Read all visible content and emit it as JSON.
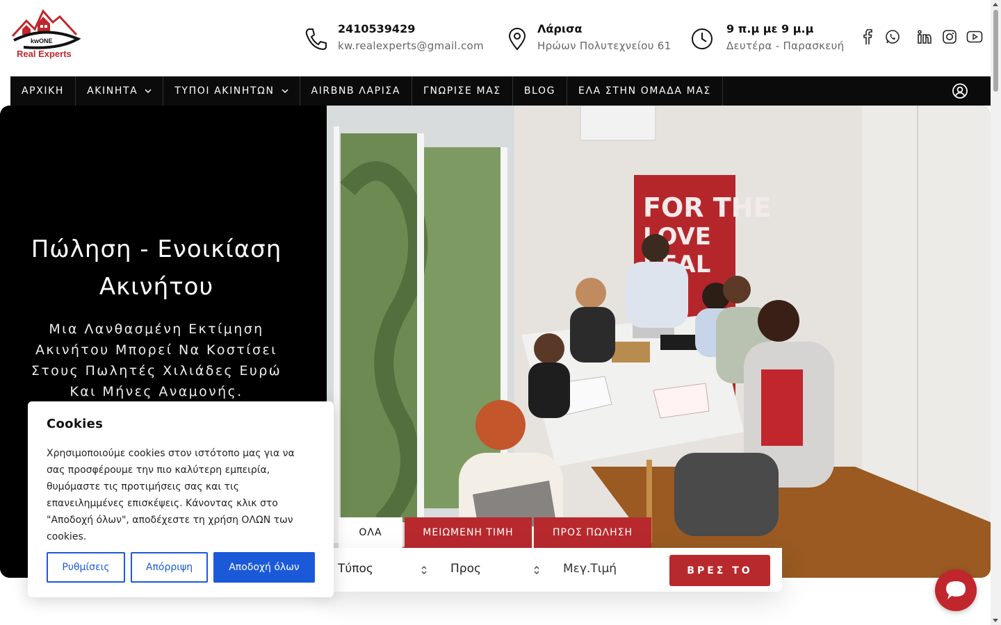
{
  "brand": {
    "name": "Real Experts",
    "sub_logo": "kwONE"
  },
  "header": {
    "phone": {
      "number": "2410539429",
      "email": "kw.realexperts@gmail.com",
      "icon": "phone-icon"
    },
    "location": {
      "city": "Λάρισα",
      "address": "Ηρώων Πολυτεχνείου 61",
      "icon": "map-pin-icon"
    },
    "hours": {
      "time": "9 π.μ με 9 μ.μ",
      "days": "Δευτέρα - Παρασκευή",
      "icon": "clock-icon"
    },
    "socials": [
      "facebook-icon",
      "whatsapp-icon",
      "linkedin-icon",
      "instagram-icon",
      "youtube-icon"
    ]
  },
  "nav": {
    "items": [
      {
        "label": "ΑΡΧΙΚΗ",
        "dropdown": false
      },
      {
        "label": "ΑΚΙΝΗΤΑ",
        "dropdown": true
      },
      {
        "label": "ΤΥΠΟΙ ΑΚΙΝΗΤΩΝ",
        "dropdown": true
      },
      {
        "label": "AIRBNB ΛΑΡΙΣΑ",
        "dropdown": false
      },
      {
        "label": "ΓΝΩΡΙΣΕ ΜΑΣ",
        "dropdown": false
      },
      {
        "label": "BLOG",
        "dropdown": false
      },
      {
        "label": "ΕΛΑ ΣΤΗΝ ΟΜΑΔΑ ΜΑΣ",
        "dropdown": false
      }
    ]
  },
  "hero": {
    "title": "Πώληση - Ενοικίαση Ακινήτου",
    "subtitle": "Μια Λανθασμένη Εκτίμηση Ακινήτου Μπορεί Να Κοστίσει Στους Πωλητές Χιλιάδες Ευρώ Και Μήνες Αναμονής."
  },
  "search": {
    "tabs": [
      "ΟΛΑ",
      "ΜΕΙΩΜΕΝΗ ΤΙΜΗ",
      "ΠΡΟΣ ΠΩΛΗΣΗ"
    ],
    "active_tab": "ΟΛΑ",
    "type_select": "Τύπος",
    "purpose_select": "Προς",
    "max_price_placeholder": "Μεγ.Τιμή",
    "find_button": "ΒΡΕΣ ΤΟ"
  },
  "cookies": {
    "title": "Cookies",
    "text": "Χρησιμοποιούμε cookies στον ιστότοπο μας για να σας προσφέρουμε την πιο καλύτερη εμπειρία, θυμόμαστε τις προτιμήσεις σας και τις επανειλημμένες επισκέψεις. Κάνοντας κλικ στο \"Αποδοχή όλων\", αποδέχεστε τη χρήση ΟΛΩΝ των cookies.",
    "settings_button": "Ρυθμίσεις",
    "reject_button": "Απόρριψη",
    "accept_button": "Αποδοχή όλων"
  },
  "colors": {
    "brand_red": "#b8292e",
    "cookie_blue": "#1a5ad8",
    "nav_bg": "#0b0b0b"
  }
}
